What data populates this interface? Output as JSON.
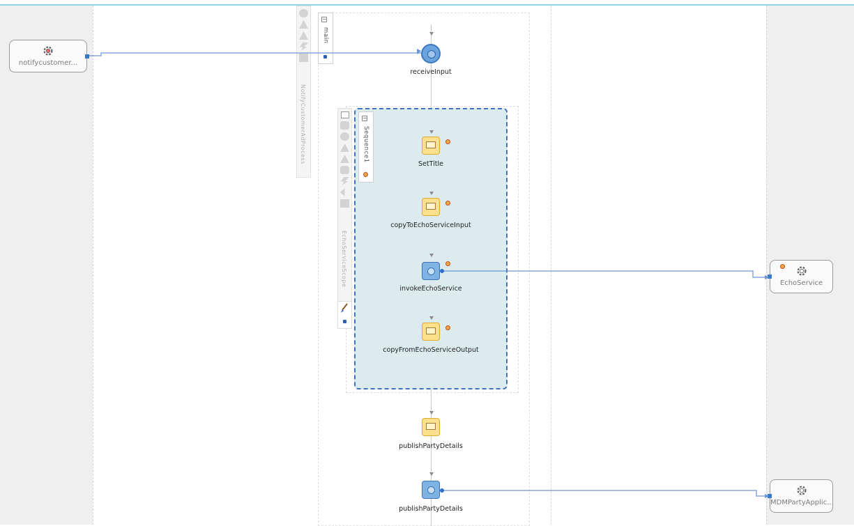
{
  "partners": {
    "left": {
      "label": "notifycustomer..."
    },
    "echo": {
      "label": "EchoService"
    },
    "mdm": {
      "label": "MDMPartyApplic..."
    }
  },
  "process": {
    "name": "NotifyCustomerAdProcess",
    "main_tab": "main",
    "scope_name": "EchoServiceScope",
    "sequence_tab": "Sequence1"
  },
  "activities": {
    "receive": {
      "label": "receiveInput",
      "icon": "receive-icon"
    },
    "set_title": {
      "label": "SetTitle",
      "icon": "assign-icon"
    },
    "copy_to": {
      "label": "copyToEchoServiceInput",
      "icon": "assign-icon"
    },
    "invoke_echo": {
      "label": "invokeEchoService",
      "icon": "invoke-icon"
    },
    "copy_from": {
      "label": "copyFromEchoServiceOutput",
      "icon": "assign-icon"
    },
    "publish_assign": {
      "label": "publishPartyDetails",
      "icon": "assign-icon"
    },
    "publish_invoke": {
      "label": "publishPartyDetails",
      "icon": "invoke-icon"
    }
  },
  "colors": {
    "scope_fill": "#dcecee",
    "scope_border": "#3f73bd",
    "assign_fill": "#fde08c",
    "invoke_fill": "#7fb3e3",
    "link": "#6b93d6"
  }
}
